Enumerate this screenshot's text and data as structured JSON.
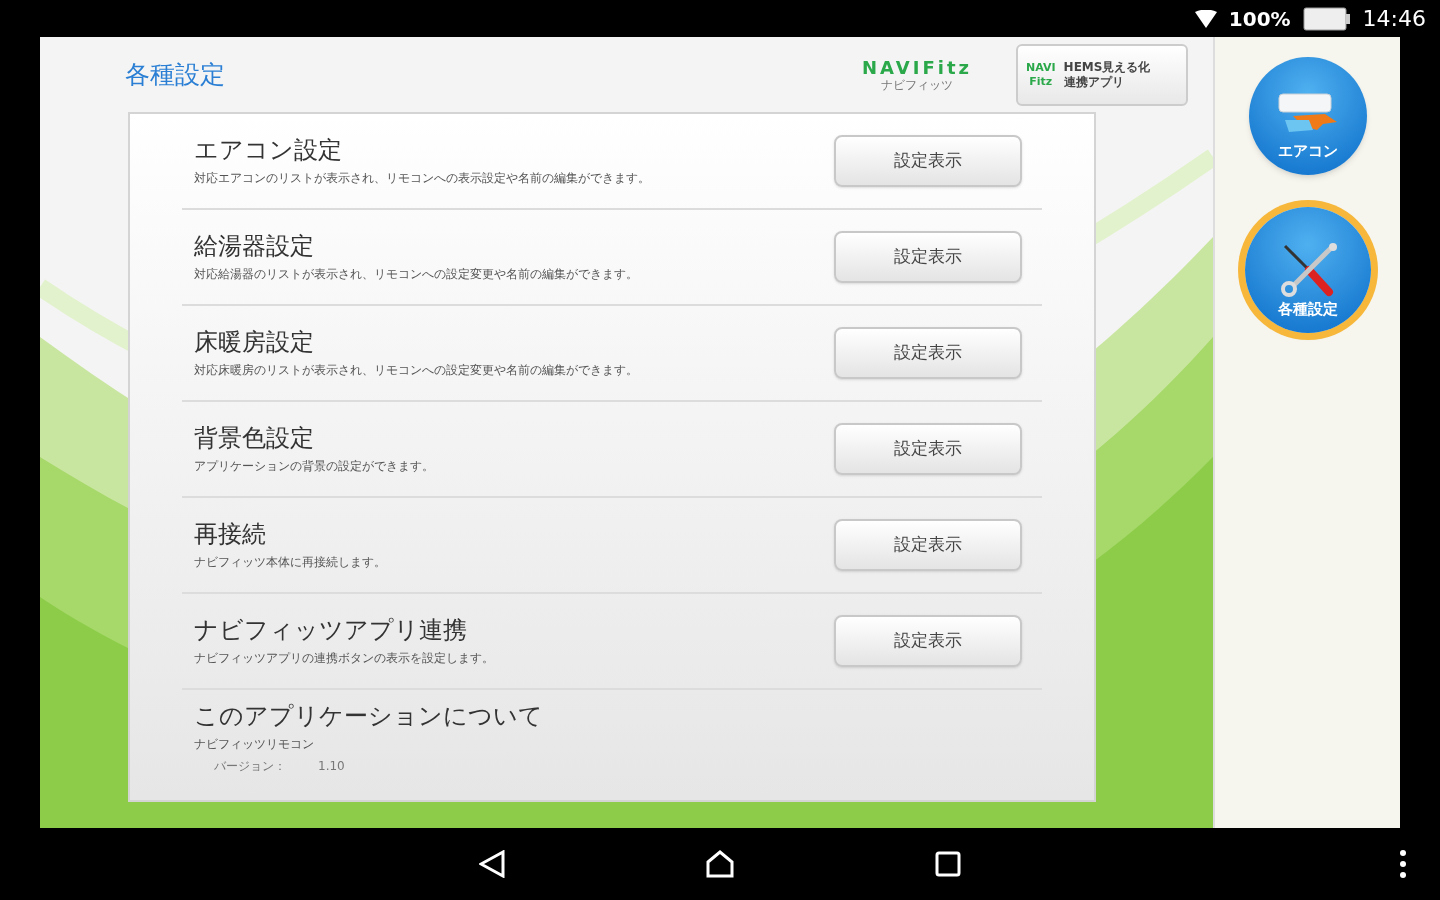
{
  "status_bar": {
    "battery": "100%",
    "time": "14:46"
  },
  "header": {
    "title": "各種設定",
    "logo": {
      "letters": "NAVIFitz",
      "caption": "ナビフィッツ"
    },
    "link_button": {
      "logo_top": "NAVI",
      "logo_bottom": "Fitz",
      "label_top": "HEMS見える化",
      "label_bottom": "連携アプリ"
    }
  },
  "settings": [
    {
      "kind": "setting",
      "title": "エアコン設定",
      "description": "対応エアコンのリストが表示され、リモコンへの表示設定や名前の編集ができます。",
      "button": "設定表示"
    },
    {
      "kind": "setting",
      "title": "給湯器設定",
      "description": "対応給湯器のリストが表示され、リモコンへの設定変更や名前の編集ができます。",
      "button": "設定表示"
    },
    {
      "kind": "setting",
      "title": "床暖房設定",
      "description": "対応床暖房のリストが表示され、リモコンへの設定変更や名前の編集ができます。",
      "button": "設定表示"
    },
    {
      "kind": "setting",
      "title": "背景色設定",
      "description": "アプリケーションの背景の設定ができます。",
      "button": "設定表示"
    },
    {
      "kind": "setting",
      "title": "再接続",
      "description": "ナビフィッツ本体に再接続します。",
      "button": "設定表示"
    },
    {
      "kind": "setting",
      "title": "ナビフィッツアプリ連携",
      "description": "ナビフィッツアプリの連携ボタンの表示を設定します。",
      "button": "設定表示"
    },
    {
      "kind": "about",
      "title": "このアプリケーションについて",
      "description": "ナビフィッツリモコン",
      "version_label": "バージョン：",
      "version": "1.10"
    }
  ],
  "nav": [
    {
      "kind": "aircon",
      "label": "エアコン",
      "selected": false
    },
    {
      "kind": "tools",
      "label": "各種設定",
      "selected": true
    }
  ]
}
